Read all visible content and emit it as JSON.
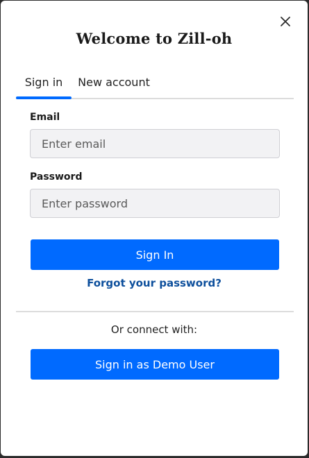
{
  "modal": {
    "title": "Welcome to Zill-oh",
    "close_icon": "close-icon"
  },
  "tabs": [
    {
      "label": "Sign in",
      "active": true
    },
    {
      "label": "New account",
      "active": false
    }
  ],
  "form": {
    "email": {
      "label": "Email",
      "placeholder": "Enter email",
      "value": ""
    },
    "password": {
      "label": "Password",
      "placeholder": "Enter password",
      "value": ""
    },
    "submit_label": "Sign In",
    "forgot_label": "Forgot your password?"
  },
  "alt_login": {
    "prompt": "Or connect with:",
    "demo_label": "Sign in as Demo User"
  },
  "colors": {
    "accent": "#006aff",
    "link": "#0d4f9c",
    "input_bg": "#f2f2f4"
  }
}
